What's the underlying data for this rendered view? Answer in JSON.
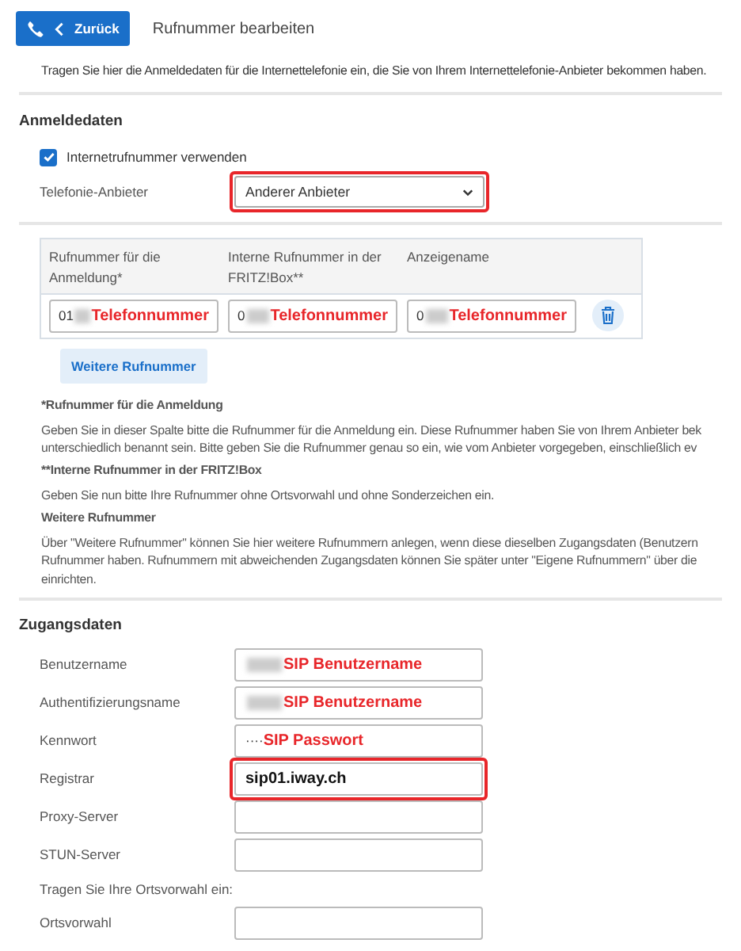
{
  "header": {
    "back_button": "Zurück",
    "title": "Rufnummer bearbeiten"
  },
  "intro": "Tragen Sie hier die Anmeldedaten für die Internettelefonie ein, die Sie von Ihrem Internettelefonie-Anbieter bekommen haben.",
  "anmeldedaten": {
    "heading": "Anmeldedaten",
    "checkbox": {
      "label": "Internetrufnummer verwenden",
      "checked": true
    },
    "provider": {
      "label": "Telefonie-Anbieter",
      "value": "Anderer Anbieter",
      "highlighted": true
    }
  },
  "numbers_table": {
    "columns": [
      "Rufnummer für die Anmeldung*",
      "Interne Rufnummer in der FRITZ!Box**",
      "Anzeigename"
    ],
    "rows": [
      [
        {
          "prefix": "01",
          "masked": true,
          "overlay": "Telefonnummer"
        },
        {
          "prefix": "0",
          "masked": true,
          "overlay": "Telefonnummer"
        },
        {
          "prefix": "0",
          "masked": true,
          "overlay": "Telefonnummer"
        }
      ]
    ],
    "add_button": "Weitere Rufnummer"
  },
  "notes": [
    {
      "heading": "*Rufnummer für die Anmeldung",
      "lines": [
        "Geben Sie in dieser Spalte bitte die Rufnummer für die Anmeldung ein. Diese Rufnummer haben Sie von Ihrem Anbieter bek",
        "unterschiedlich benannt sein. Bitte geben Sie die Rufnummer genau so ein, wie vom Anbieter vorgegeben, einschließlich ev"
      ]
    },
    {
      "heading": "**Interne Rufnummer in der FRITZ!Box",
      "lines": [
        "Geben Sie nun bitte Ihre Rufnummer ohne Ortsvorwahl und ohne Sonderzeichen ein."
      ]
    },
    {
      "heading": "Weitere Rufnummer",
      "lines": [
        "Über \"Weitere Rufnummer\" können Sie hier weitere Rufnummern anlegen, wenn diese dieselben Zugangsdaten (Benutzern",
        "Rufnummer haben. Rufnummern mit abweichenden Zugangsdaten können Sie später unter \"Eigene Rufnummern\" über die",
        "einrichten."
      ]
    }
  ],
  "zugangsdaten": {
    "heading": "Zugangsdaten",
    "fields": [
      {
        "kind": "field",
        "label": "Benutzername",
        "masked": true,
        "overlay": "SIP Benutzername",
        "highlighted": false
      },
      {
        "kind": "field",
        "label": "Authentifizierungsname",
        "masked": true,
        "overlay": "SIP Benutzername",
        "highlighted": false
      },
      {
        "kind": "field",
        "label": "Kennwort",
        "prefix": "····",
        "masked": false,
        "overlay": "SIP Passwort",
        "highlighted": false
      },
      {
        "kind": "field",
        "label": "Registrar",
        "value": "sip01.iway.ch",
        "masked": false,
        "highlighted": true
      },
      {
        "kind": "field",
        "label": "Proxy-Server",
        "masked": false,
        "highlighted": false
      },
      {
        "kind": "field",
        "label": "STUN-Server",
        "masked": false,
        "highlighted": false
      },
      {
        "kind": "hint",
        "label": "Tragen Sie Ihre Ortsvorwahl ein:"
      },
      {
        "kind": "field",
        "label": "Ortsvorwahl",
        "masked": false,
        "highlighted": false
      }
    ]
  }
}
